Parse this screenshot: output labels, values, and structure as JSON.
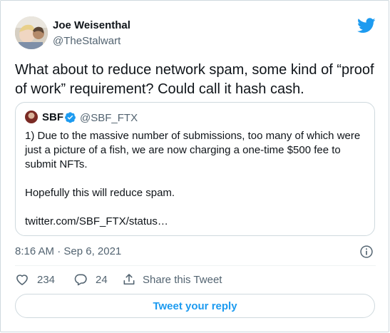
{
  "author": {
    "name": "Joe Weisenthal",
    "handle": "@TheStalwart"
  },
  "tweet": {
    "text": "What about to reduce network spam, some kind of “proof of work” requirement? Could call it hash cash."
  },
  "quoted": {
    "name": "SBF",
    "handle": "@SBF_FTX",
    "line1": "1) Due to the massive number of submissions, too many of which were just a picture of a fish, we are now charging a one-time $500 fee to submit NFTs.",
    "line2": "Hopefully this will reduce spam.",
    "link": "twitter.com/SBF_FTX/status…"
  },
  "meta": {
    "timestamp": "8:16 AM · Sep 6, 2021"
  },
  "actions": {
    "likes": "234",
    "replies": "24",
    "share_label": "Share this Tweet"
  },
  "reply_button": "Tweet your reply",
  "colors": {
    "accent": "#1d9bf0",
    "text": "#0f1419",
    "muted": "#536471",
    "border": "#cfd9de"
  },
  "icons": [
    "twitter-bird-icon",
    "verified-badge-icon",
    "info-icon",
    "heart-icon",
    "reply-bubble-icon",
    "share-icon"
  ]
}
